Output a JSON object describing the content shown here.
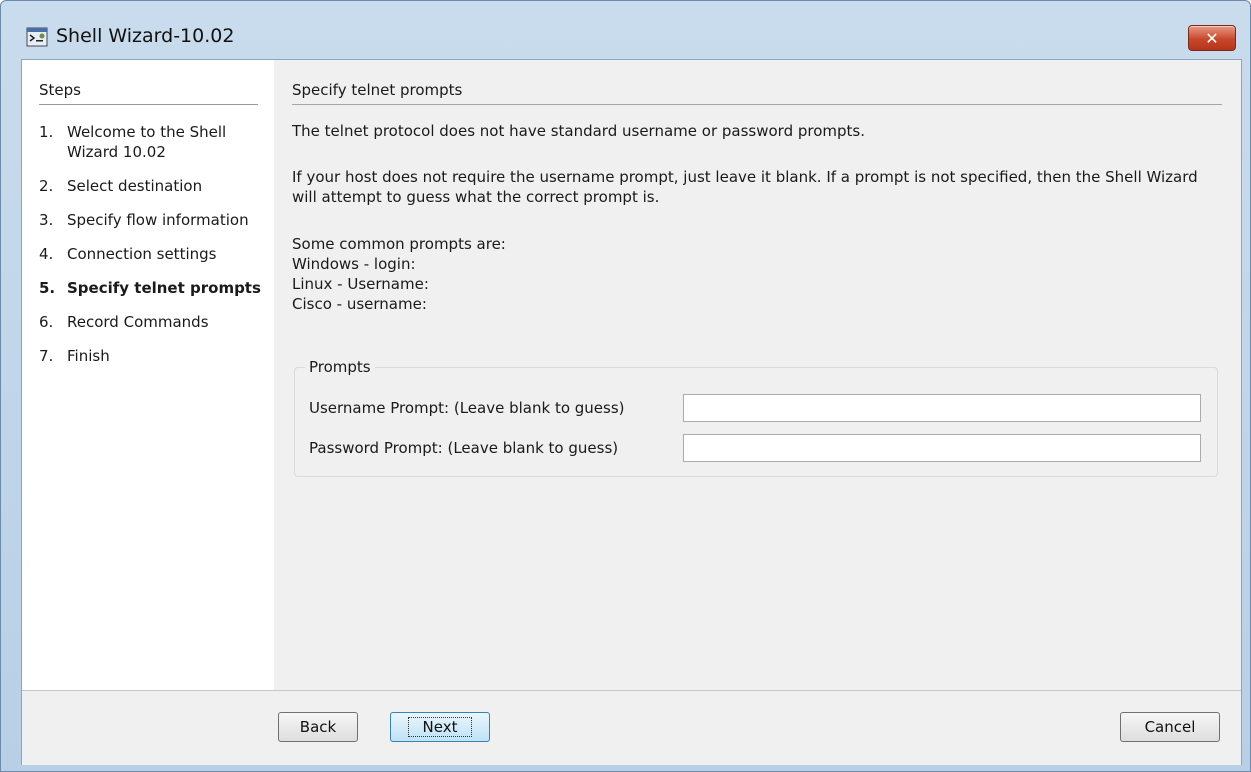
{
  "window": {
    "title": "Shell Wizard-10.02",
    "close_label": "✕",
    "app_icon": "shell-wizard-icon",
    "close_icon": "close-icon",
    "close_color": "#c7482d"
  },
  "sidebar": {
    "title": "Steps",
    "steps": [
      {
        "num": "1.",
        "label": "Welcome to the Shell Wizard 10.02",
        "current": false
      },
      {
        "num": "2.",
        "label": "Select destination",
        "current": false
      },
      {
        "num": "3.",
        "label": "Specify flow information",
        "current": false
      },
      {
        "num": "4.",
        "label": "Connection settings",
        "current": false
      },
      {
        "num": "5.",
        "label": "Specify telnet prompts",
        "current": true
      },
      {
        "num": "6.",
        "label": "Record Commands",
        "current": false
      },
      {
        "num": "7.",
        "label": "Finish",
        "current": false
      }
    ]
  },
  "main": {
    "title": "Specify telnet prompts",
    "intro": "The telnet protocol does not have standard username or password prompts.",
    "hint": "If your host does not require the username prompt, just leave it blank. If a prompt is not specified, then the Shell Wizard will attempt to guess what the correct prompt is.",
    "common_heading": "Some common prompts are:",
    "common": [
      "Windows - login:",
      "Linux - Username:",
      "Cisco - username:"
    ],
    "prompts_legend": "Prompts",
    "username_label": "Username Prompt: (Leave blank to guess)",
    "username_value": "",
    "password_label": "Password Prompt:  (Leave blank to guess)",
    "password_value": ""
  },
  "footer": {
    "back": "Back",
    "next": "Next",
    "cancel": "Cancel"
  }
}
